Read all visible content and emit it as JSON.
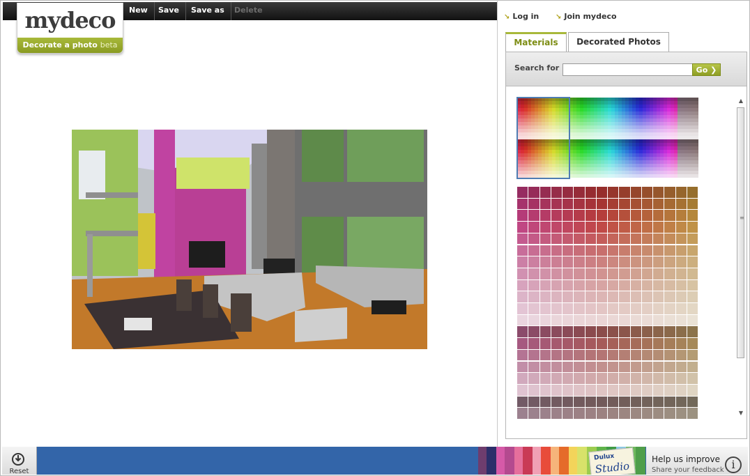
{
  "toolbar": {
    "new": "New",
    "save": "Save",
    "save_as": "Save as",
    "delete": "Delete"
  },
  "logo": {
    "name": "mydeco",
    "subtitle": "Decorate a photo",
    "beta": "beta"
  },
  "auth": {
    "login": "Log in",
    "join": "Join mydeco"
  },
  "tabs": [
    {
      "label": "Materials",
      "active": true
    },
    {
      "label": "Decorated Photos",
      "active": false
    }
  ],
  "search": {
    "label": "Search for",
    "value": "",
    "go": "Go",
    "go_icon": "chevron-right-icon"
  },
  "scrollbar": {
    "up_icon": "triangle-up-icon",
    "down_icon": "triangle-down-icon"
  },
  "bottom": {
    "reset": "Reset",
    "reset_icon": "power-icon",
    "brand_top": "Dulux",
    "brand_bottom": "Studio",
    "feedback_title": "Help us improve",
    "feedback_sub": "Share your feedback",
    "info_icon": "info-icon",
    "info_glyph": "i"
  },
  "colors": {
    "accent": "#a8b83a",
    "bottom_bar": "#3365a9",
    "selection": "#4f7db3"
  }
}
